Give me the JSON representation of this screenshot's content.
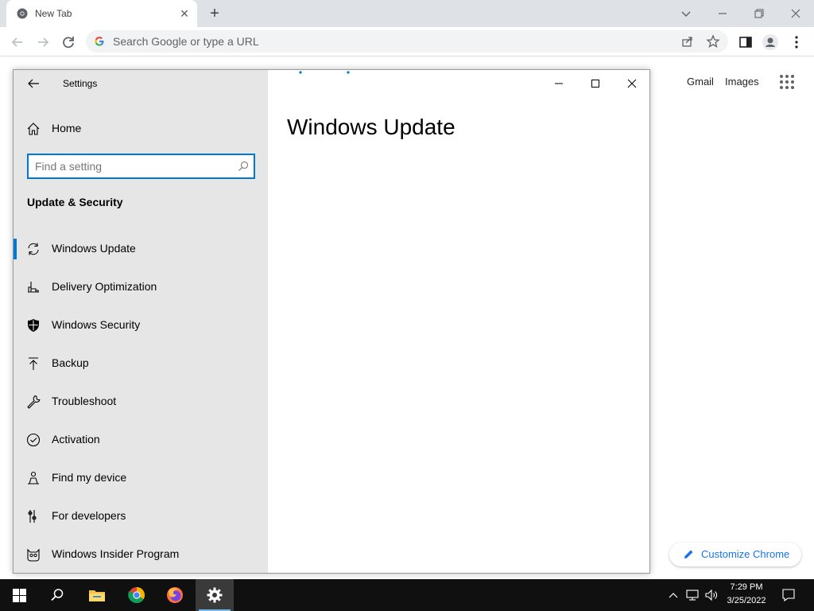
{
  "browser": {
    "tab_title": "New Tab",
    "omnibox_placeholder": "Search Google or type a URL",
    "ntp_links": {
      "gmail": "Gmail",
      "images": "Images"
    },
    "customize_label": "Customize Chrome"
  },
  "settings": {
    "window_title": "Settings",
    "home_label": "Home",
    "search_placeholder": "Find a setting",
    "section_title": "Update & Security",
    "page_title": "Windows Update",
    "nav_items": [
      {
        "label": "Windows Update",
        "icon": "sync-icon",
        "selected": true
      },
      {
        "label": "Delivery Optimization",
        "icon": "delivery-icon",
        "selected": false
      },
      {
        "label": "Windows Security",
        "icon": "shield-icon",
        "selected": false
      },
      {
        "label": "Backup",
        "icon": "backup-icon",
        "selected": false
      },
      {
        "label": "Troubleshoot",
        "icon": "wrench-icon",
        "selected": false
      },
      {
        "label": "Activation",
        "icon": "check-circle-icon",
        "selected": false
      },
      {
        "label": "Find my device",
        "icon": "person-location-icon",
        "selected": false
      },
      {
        "label": "For developers",
        "icon": "developer-icon",
        "selected": false
      },
      {
        "label": "Windows Insider Program",
        "icon": "insider-icon",
        "selected": false
      }
    ]
  },
  "taskbar": {
    "time": "7:29 PM",
    "date": "3/25/2022",
    "pinned": [
      "start-icon",
      "search-icon",
      "file-explorer-icon",
      "chrome-icon",
      "firefox-icon",
      "settings-icon"
    ]
  },
  "colors": {
    "accent": "#0078d7",
    "link_blue": "#1a73e8",
    "nav_bg": "#e6e6e6",
    "taskbar_bg": "#101010"
  }
}
